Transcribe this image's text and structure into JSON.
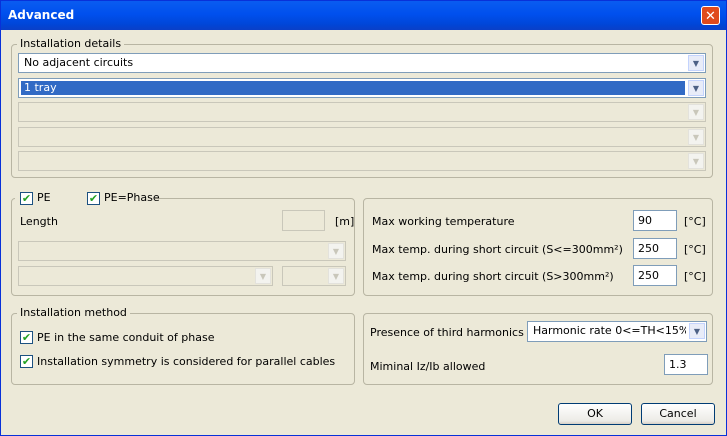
{
  "window": {
    "title": "Advanced",
    "close_glyph": "✕"
  },
  "installation_details": {
    "label": "Installation details",
    "combo1": "No adjacent circuits",
    "combo2": "1 tray",
    "combo3": "",
    "combo4": "",
    "combo5": ""
  },
  "pe": {
    "pe_label": "PE",
    "pe_checked": true,
    "pe_phase_label": "PE=Phase",
    "pe_phase_checked": true,
    "length_label": "Length",
    "length_value": "",
    "length_unit": "[m]"
  },
  "temps": {
    "max_working_label": "Max working temperature",
    "max_working_value": "90",
    "max_sc_small_label": "Max temp. during short circuit (S<=300mm²)",
    "max_sc_small_value": "250",
    "max_sc_large_label": "Max temp. during short circuit (S>300mm²)",
    "max_sc_large_value": "250",
    "unit": "[°C]"
  },
  "installation_method": {
    "label": "Installation method",
    "opt1_label": "PE in the same conduit of phase",
    "opt1_checked": true,
    "opt2_label": "Installation symmetry is considered for parallel cables",
    "opt2_checked": true
  },
  "harmonics": {
    "label": "Presence of third harmonics",
    "value": "Harmonic rate 0<=TH<15%",
    "min_label": "Miminal Iz/Ib allowed",
    "min_value": "1.3"
  },
  "buttons": {
    "ok": "OK",
    "cancel": "Cancel"
  },
  "icons": {
    "dropdown": "▼",
    "check": "✔"
  }
}
